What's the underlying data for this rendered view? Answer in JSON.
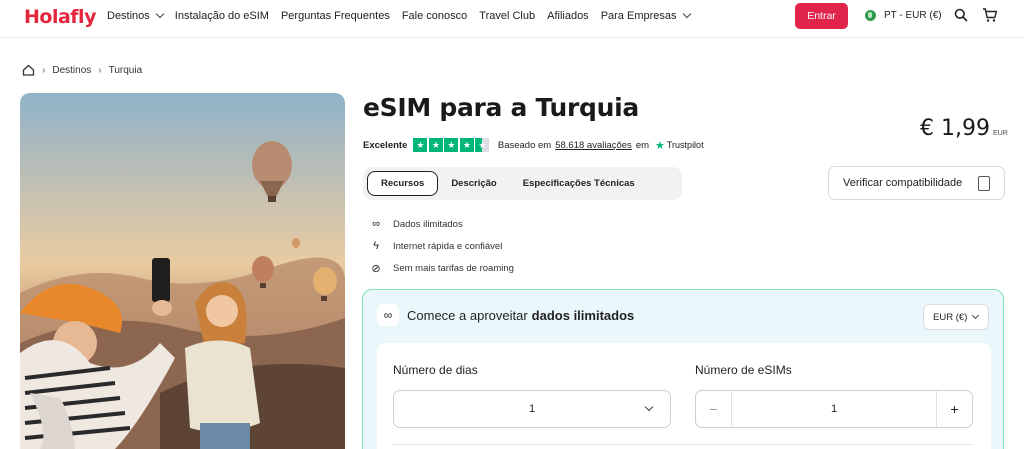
{
  "header": {
    "logo": "Holafly",
    "nav": [
      {
        "label": "Destinos",
        "dropdown": true
      },
      {
        "label": "Instalação do eSIM",
        "dropdown": false
      },
      {
        "label": "Perguntas Frequentes",
        "dropdown": false
      },
      {
        "label": "Fale conosco",
        "dropdown": false
      },
      {
        "label": "Travel Club",
        "dropdown": false
      },
      {
        "label": "Afiliados",
        "dropdown": false
      },
      {
        "label": "Para Empresas",
        "dropdown": true
      }
    ],
    "login_label": "Entrar",
    "locale": "PT - EUR (€)",
    "icons": [
      "search-icon",
      "cart-icon"
    ]
  },
  "breadcrumb": [
    "Destinos",
    "Turquia"
  ],
  "product": {
    "title": "eSIM para a Turquia",
    "price": "€ 1,99",
    "currency_code": "EUR",
    "rating_label": "Excelente",
    "stars": 4.5,
    "reviews_prefix": "Baseado em",
    "reviews_link": "58.618 avaliações",
    "reviews_suffix": "em",
    "trustpilot": "Trustpilot",
    "tabs": [
      {
        "label": "Recursos",
        "active": true
      },
      {
        "label": "Descrição",
        "active": false
      },
      {
        "label": "Especificações Técnicas",
        "active": false
      }
    ],
    "verify_label": "Verificar compatibilidade",
    "features": [
      {
        "icon": "infinity-icon",
        "label": "Dados ilimitados"
      },
      {
        "icon": "lightning-icon",
        "label": "Internet rápida e confiável"
      },
      {
        "icon": "no-roaming-icon",
        "label": "Sem mais tarifas de roaming"
      }
    ]
  },
  "plan": {
    "heading_prefix": "Comece a aproveitar",
    "heading_bold": "dados ilimitados",
    "currency_select": "EUR (€)",
    "days_label": "Número de dias",
    "days_value": "1",
    "esims_label": "Número de eSIMs",
    "esims_value": "1"
  },
  "colors": {
    "brand": "#e5263c",
    "login_button": "#e0244a",
    "trustpilot_green": "#00b67a",
    "card_border": "#7ee2b4",
    "card_bg": "#eaf8fb"
  }
}
